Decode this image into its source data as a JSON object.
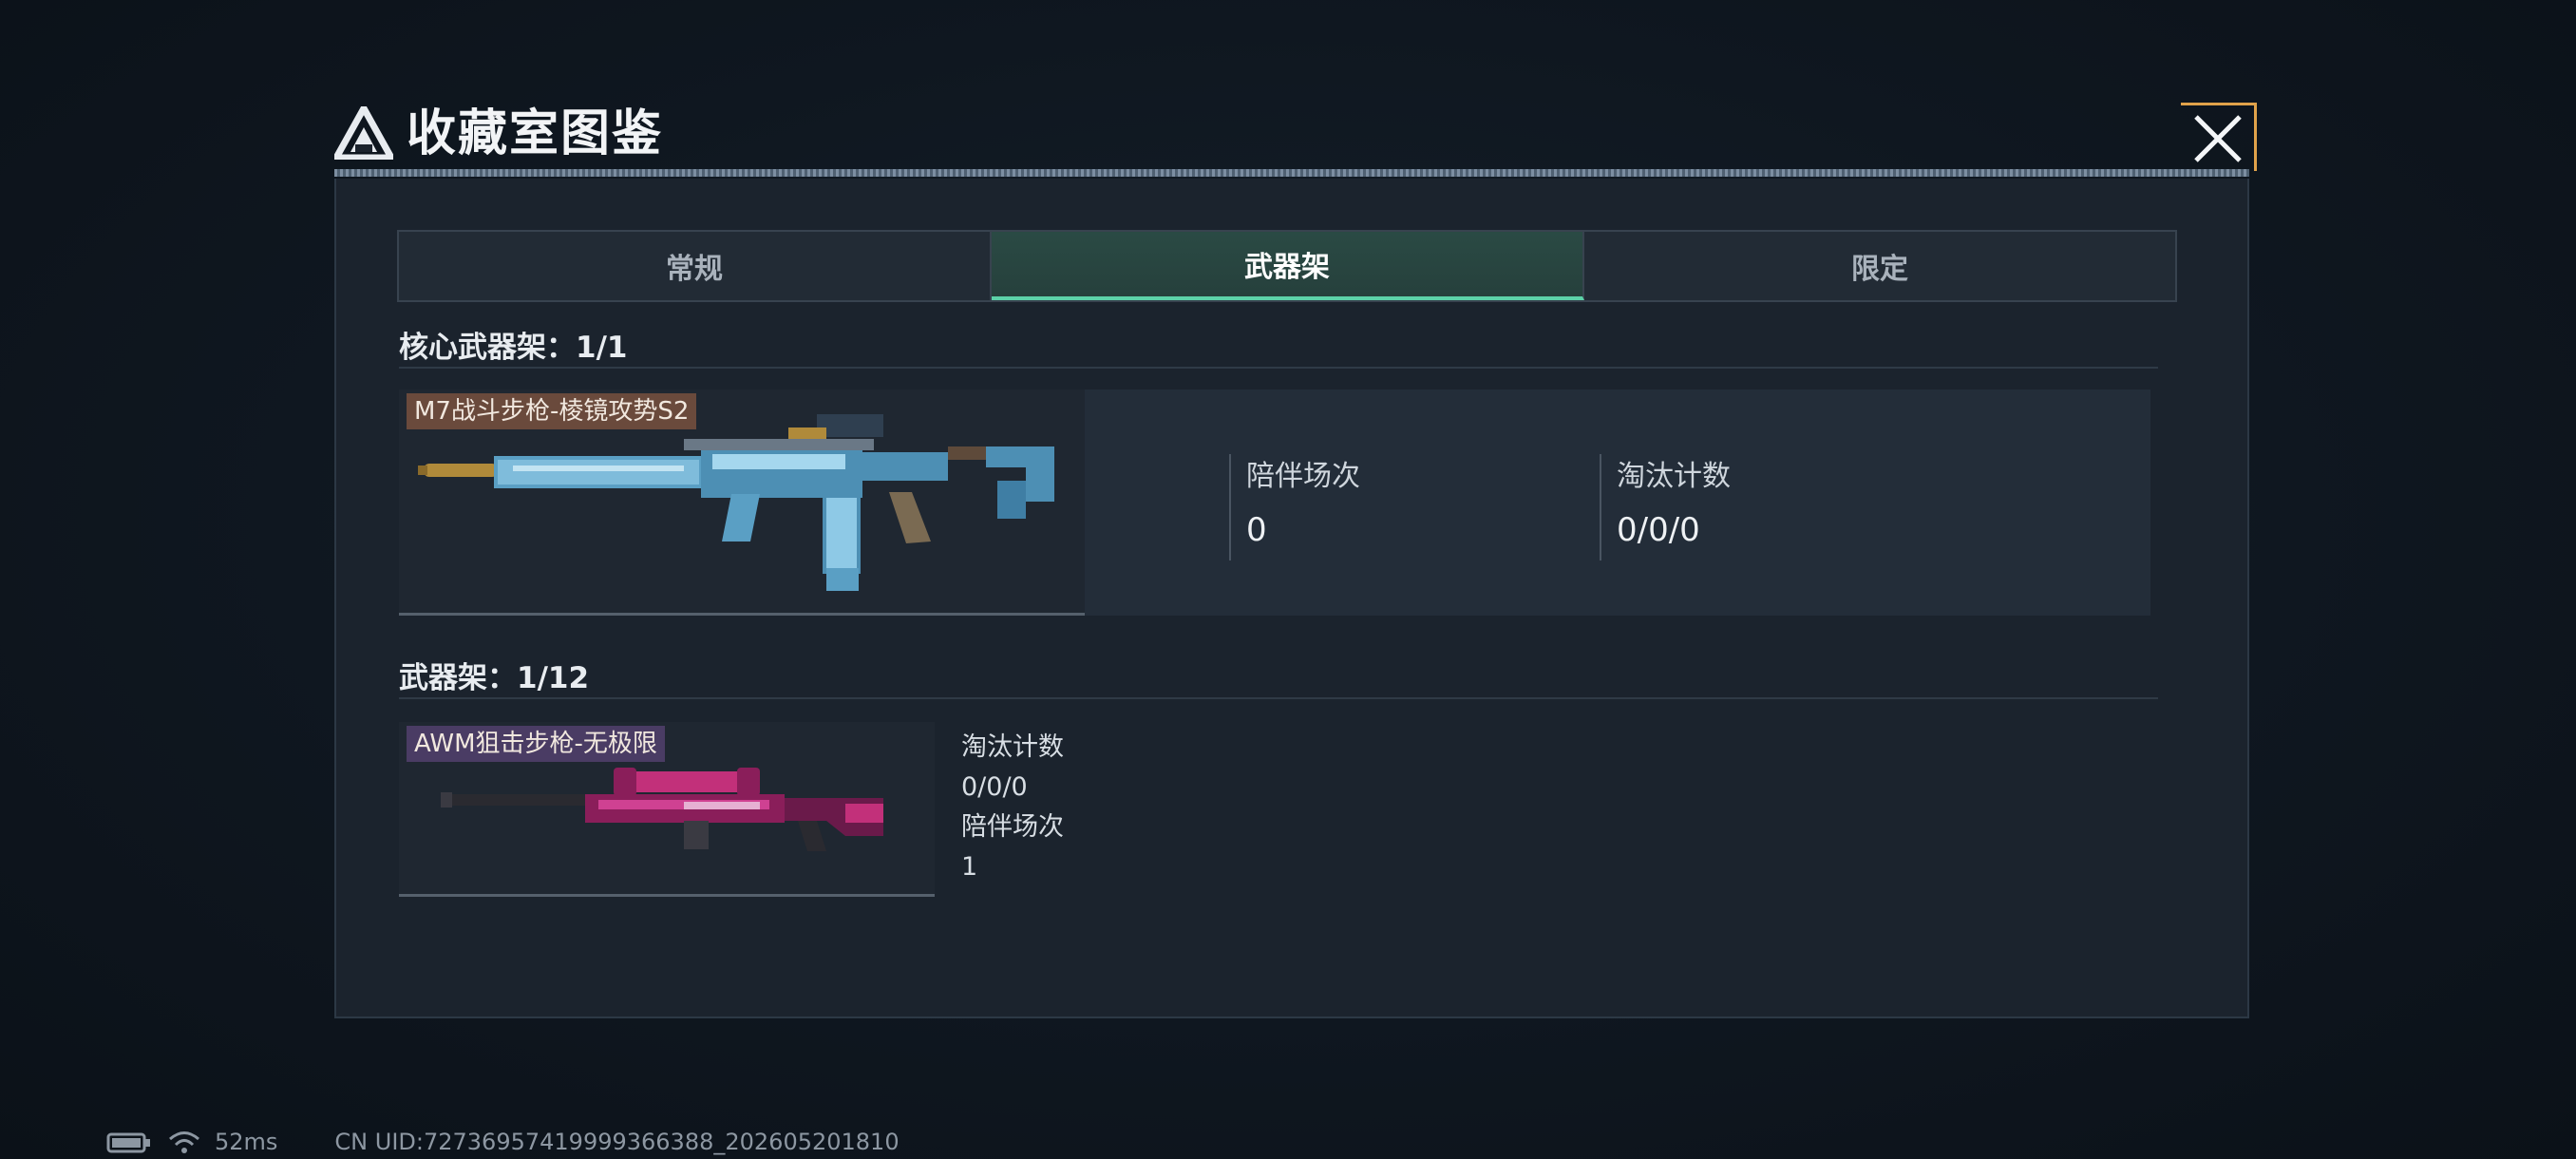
{
  "modal": {
    "title": "收藏室图鉴"
  },
  "tabs": [
    {
      "label": "常规",
      "active": false
    },
    {
      "label": "武器架",
      "active": true
    },
    {
      "label": "限定",
      "active": false
    }
  ],
  "core_section": {
    "header": "核心武器架：1/1",
    "weapon": {
      "name": "M7战斗步枪-棱镜攻势S2",
      "icon": "m7-rifle-image",
      "stats": [
        {
          "label": "陪伴场次",
          "value": "0"
        },
        {
          "label": "淘汰计数",
          "value": "0/0/0"
        }
      ]
    }
  },
  "rack_section": {
    "header": "武器架：1/12",
    "weapon": {
      "name": "AWM狙击步枪-无极限",
      "icon": "awm-sniper-image",
      "stats": [
        {
          "label": "淘汰计数",
          "value": "0/0/0"
        },
        {
          "label": "陪伴场次",
          "value": "1"
        }
      ]
    }
  },
  "footer": {
    "ping": "52ms",
    "uid": "CN UID:72736957419999366388_202605201810"
  },
  "colors": {
    "accent": "#5cd2a8",
    "close_corner": "#e0a24a",
    "tag_brown": "#6a4a3c",
    "tag_purple": "#4a3c64"
  }
}
